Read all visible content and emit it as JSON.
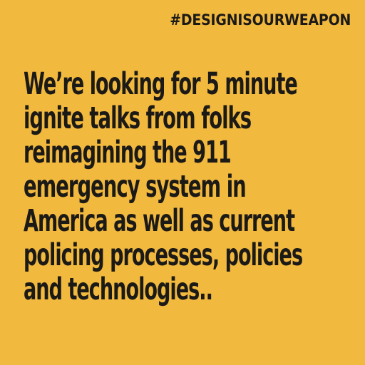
{
  "hashtag": "#DESIGNISOURWEAPON",
  "message": {
    "lines": [
      [
        "We’re looking for ",
        "5",
        " minute"
      ],
      [
        " ignite talks from folks"
      ],
      [
        "reimagining the ",
        "911"
      ],
      [
        "emergency system in"
      ],
      [
        "America as well as current"
      ],
      [
        "policing processes, policies"
      ],
      [
        "and technologies.."
      ]
    ]
  },
  "colors": {
    "background": "#f2b93f",
    "text": "#1c1a17"
  }
}
